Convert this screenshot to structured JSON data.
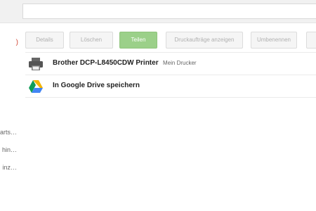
{
  "sidebar": {
    "active_item": ")",
    "items": [
      "arts…",
      "hin…",
      "inz…"
    ]
  },
  "toolbar": {
    "details": "Details",
    "delete": "Löschen",
    "share": "Teilen",
    "show_jobs": "Druckaufträge anzeigen",
    "rename": "Umbenennen"
  },
  "printers": [
    {
      "name": "Brother DCP-L8450CDW Printer",
      "subtitle": "Mein Drucker",
      "icon": "printer-icon"
    },
    {
      "name": "In Google Drive speichern",
      "subtitle": "",
      "icon": "google-drive-icon"
    }
  ],
  "colors": {
    "accent_green": "#9bd089",
    "active_red": "#d14836",
    "drive_green": "#0f9d58",
    "drive_yellow": "#f4b400",
    "drive_blue": "#4285f4"
  }
}
